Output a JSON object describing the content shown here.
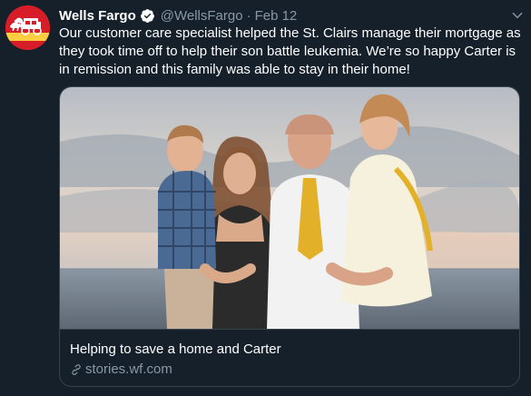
{
  "account": {
    "name": "Wells Fargo",
    "handle": "@WellsFargo",
    "separator": "·",
    "date": "Feb 12"
  },
  "tweet": {
    "lines": [
      "Our customer care specialist helped the St. Clairs manage their mortgage as",
      "they took time off to help their son battle leukemia. We’re so happy Carter is",
      "in remission and this family was able to stay in their home!"
    ]
  },
  "card": {
    "title": "Helping to save a home and Carter",
    "domain": "stories.wf.com"
  },
  "colors": {
    "background": "#15202b",
    "secondary_text": "#8899a6",
    "border": "#38444d",
    "brand_red": "#d71e28",
    "brand_yellow": "#ffcd41",
    "verified_blue": "#1da1f2"
  },
  "icons": [
    "wells-fargo-stagecoach-logo",
    "verified-badge-icon",
    "chevron-down-icon",
    "link-icon"
  ]
}
